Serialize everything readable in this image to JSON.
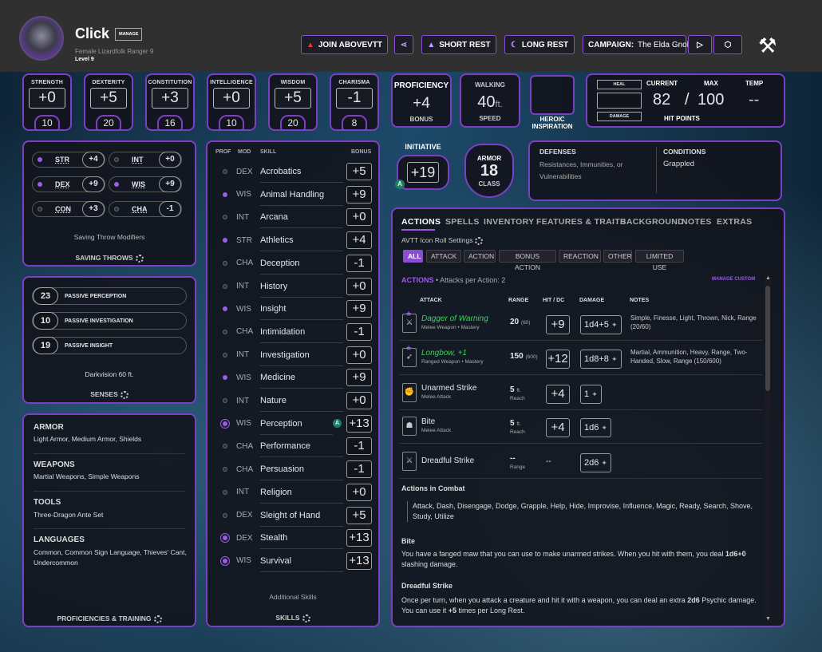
{
  "header": {
    "name": "Click",
    "manage": "MANAGE",
    "details": "Female  Lizardfolk  Ranger 9",
    "level": "Level 9",
    "join": "JOIN ABOVEVTT",
    "short_rest": "SHORT REST",
    "long_rest": "LONG REST",
    "campaign_label": "CAMPAIGN:",
    "campaign_name": "The Elda Gnolls"
  },
  "abilities": [
    {
      "name": "STRENGTH",
      "mod": "+0",
      "score": "10"
    },
    {
      "name": "DEXTERITY",
      "mod": "+5",
      "score": "20"
    },
    {
      "name": "CONSTITUTION",
      "mod": "+3",
      "score": "16"
    },
    {
      "name": "INTELLIGENCE",
      "mod": "+0",
      "score": "10"
    },
    {
      "name": "WISDOM",
      "mod": "+5",
      "score": "20"
    },
    {
      "name": "CHARISMA",
      "mod": "-1",
      "score": "8"
    }
  ],
  "proficiency": {
    "label": "PROFICIENCY",
    "value": "+4",
    "sub": "BONUS"
  },
  "walking": {
    "label": "WALKING",
    "value": "40",
    "unit": "ft.",
    "sub": "SPEED"
  },
  "heroic": {
    "label": "HEROIC INSPIRATION"
  },
  "hp": {
    "heal": "HEAL",
    "damage": "DAMAGE",
    "current_label": "CURRENT",
    "max_label": "MAX",
    "temp_label": "TEMP",
    "current": "82",
    "sep": "/",
    "max": "100",
    "temp": "--",
    "title": "HIT POINTS"
  },
  "initiative": {
    "label": "INITIATIVE",
    "value": "+19"
  },
  "armor": {
    "label": "ARMOR",
    "value": "18",
    "sub": "CLASS"
  },
  "defenses": {
    "title": "DEFENSES",
    "text": "Resistances, Immunities, or Vulnerabilities"
  },
  "conditions": {
    "title": "CONDITIONS",
    "text": "Grappled"
  },
  "saves": {
    "items": [
      {
        "name": "STR",
        "value": "+4",
        "prof": true
      },
      {
        "name": "INT",
        "value": "+0",
        "prof": false
      },
      {
        "name": "DEX",
        "value": "+9",
        "prof": true
      },
      {
        "name": "WIS",
        "value": "+9",
        "prof": true
      },
      {
        "name": "CON",
        "value": "+3",
        "prof": false
      },
      {
        "name": "CHA",
        "value": "-1",
        "prof": false
      }
    ],
    "modifiers": "Saving Throw Modifiers",
    "title": "SAVING THROWS"
  },
  "senses": {
    "items": [
      {
        "v": "23",
        "t": "PASSIVE PERCEPTION"
      },
      {
        "v": "10",
        "t": "PASSIVE INVESTIGATION"
      },
      {
        "v": "19",
        "t": "PASSIVE INSIGHT"
      }
    ],
    "darkvision": "Darkvision 60 ft.",
    "title": "SENSES"
  },
  "proficiencies": {
    "armor_t": "ARMOR",
    "armor": "Light Armor, Medium Armor, Shields",
    "weapons_t": "WEAPONS",
    "weapons": "Martial Weapons, Simple Weapons",
    "tools_t": "TOOLS",
    "tools": "Three-Dragon Ante Set",
    "lang_t": "LANGUAGES",
    "lang": "Common, Common Sign Language, Thieves' Cant, Undercommon",
    "title": "PROFICIENCIES & TRAINING"
  },
  "skills": {
    "h_prof": "PROF",
    "h_mod": "MOD",
    "h_skill": "SKILL",
    "h_bonus": "BONUS",
    "additional": "Additional Skills",
    "title": "SKILLS",
    "items": [
      {
        "mod": "DEX",
        "name": "Acrobatics",
        "bonus": "+5",
        "p": "e"
      },
      {
        "mod": "WIS",
        "name": "Animal Handling",
        "bonus": "+9",
        "p": "p"
      },
      {
        "mod": "INT",
        "name": "Arcana",
        "bonus": "+0",
        "p": "e"
      },
      {
        "mod": "STR",
        "name": "Athletics",
        "bonus": "+4",
        "p": "p"
      },
      {
        "mod": "CHA",
        "name": "Deception",
        "bonus": "-1",
        "p": "e"
      },
      {
        "mod": "INT",
        "name": "History",
        "bonus": "+0",
        "p": "e"
      },
      {
        "mod": "WIS",
        "name": "Insight",
        "bonus": "+9",
        "p": "p"
      },
      {
        "mod": "CHA",
        "name": "Intimidation",
        "bonus": "-1",
        "p": "e"
      },
      {
        "mod": "INT",
        "name": "Investigation",
        "bonus": "+0",
        "p": "e"
      },
      {
        "mod": "WIS",
        "name": "Medicine",
        "bonus": "+9",
        "p": "p"
      },
      {
        "mod": "INT",
        "name": "Nature",
        "bonus": "+0",
        "p": "e"
      },
      {
        "mod": "WIS",
        "name": "Perception",
        "bonus": "+13",
        "p": "x"
      },
      {
        "mod": "CHA",
        "name": "Performance",
        "bonus": "-1",
        "p": "e"
      },
      {
        "mod": "CHA",
        "name": "Persuasion",
        "bonus": "-1",
        "p": "e"
      },
      {
        "mod": "INT",
        "name": "Religion",
        "bonus": "+0",
        "p": "e"
      },
      {
        "mod": "DEX",
        "name": "Sleight of Hand",
        "bonus": "+5",
        "p": "e"
      },
      {
        "mod": "DEX",
        "name": "Stealth",
        "bonus": "+13",
        "p": "x"
      },
      {
        "mod": "WIS",
        "name": "Survival",
        "bonus": "+13",
        "p": "x"
      }
    ]
  },
  "tabs": [
    "ACTIONS",
    "SPELLS",
    "INVENTORY",
    "FEATURES & TRAITS",
    "BACKGROUND",
    "NOTES",
    "EXTRAS"
  ],
  "avtt": "AVTT Icon Roll Settings",
  "filters": [
    "ALL",
    "ATTACK",
    "ACTION",
    "BONUS ACTION",
    "REACTION",
    "OTHER",
    "LIMITED USE"
  ],
  "actions": {
    "title": "ACTIONS",
    "sub": "• Attacks per Action: 2",
    "manage": "MANAGE CUSTOM",
    "h_attack": "ATTACK",
    "h_range": "RANGE",
    "h_hit": "HIT / DC",
    "h_damage": "DAMAGE",
    "h_notes": "NOTES",
    "rows": [
      {
        "name": "Dagger of Warning",
        "sub": "Melee Weapon • Mastery",
        "range": "20",
        "range2": "(60)",
        "hit": "+9",
        "damage": "1d4+5",
        "notes": "Simple, Finesse, Light, Thrown, Nick, Range (20/60)"
      },
      {
        "name": "Longbow, +1",
        "sub": "Ranged Weapon • Mastery",
        "range": "150",
        "range2": "(600)",
        "hit": "+12",
        "damage": "1d8+8",
        "notes": "Martial, Ammunition, Heavy, Range, Two-Handed, Slow, Range (150/600)"
      },
      {
        "name": "Unarmed Strike",
        "sub": "Melee Attack",
        "range": "5",
        "range2": "ft.",
        "range3": "Reach",
        "hit": "+4",
        "damage": "1",
        "notes": ""
      },
      {
        "name": "Bite",
        "sub": "Melee Attack",
        "range": "5",
        "range2": "ft.",
        "range3": "Reach",
        "hit": "+4",
        "damage": "1d6",
        "notes": ""
      },
      {
        "name": "Dreadful Strike",
        "sub": "",
        "range": "--",
        "range2": "",
        "range3": "Range",
        "hit": "--",
        "damage": "2d6",
        "notes": ""
      }
    ],
    "combat_title": "Actions in Combat",
    "combat": "Attack, Dash, Disengage, Dodge, Grapple, Help, Hide, Improvise, Influence, Magic, Ready, Search, Shove, Study, Utilize",
    "bite_title": "Bite",
    "bite1": "You have a fanged maw that you can use to make unarmed strikes. When you hit with them, you deal",
    "bite2": "1d6+0",
    "bite3": "slashing damage.",
    "dread_title": "Dreadful Strike",
    "dread1": "Once per turn, when you attack a creature and hit it with a weapon, you can deal an extra",
    "dread2": "2d6",
    "dread3": "Psychic damage. You can use it",
    "dread4": "+5",
    "dread5": "times per Long Rest."
  },
  "colors": {
    "accent": "#7c3fc4",
    "green": "#3ecf5e",
    "prof": "#9b5de5"
  }
}
